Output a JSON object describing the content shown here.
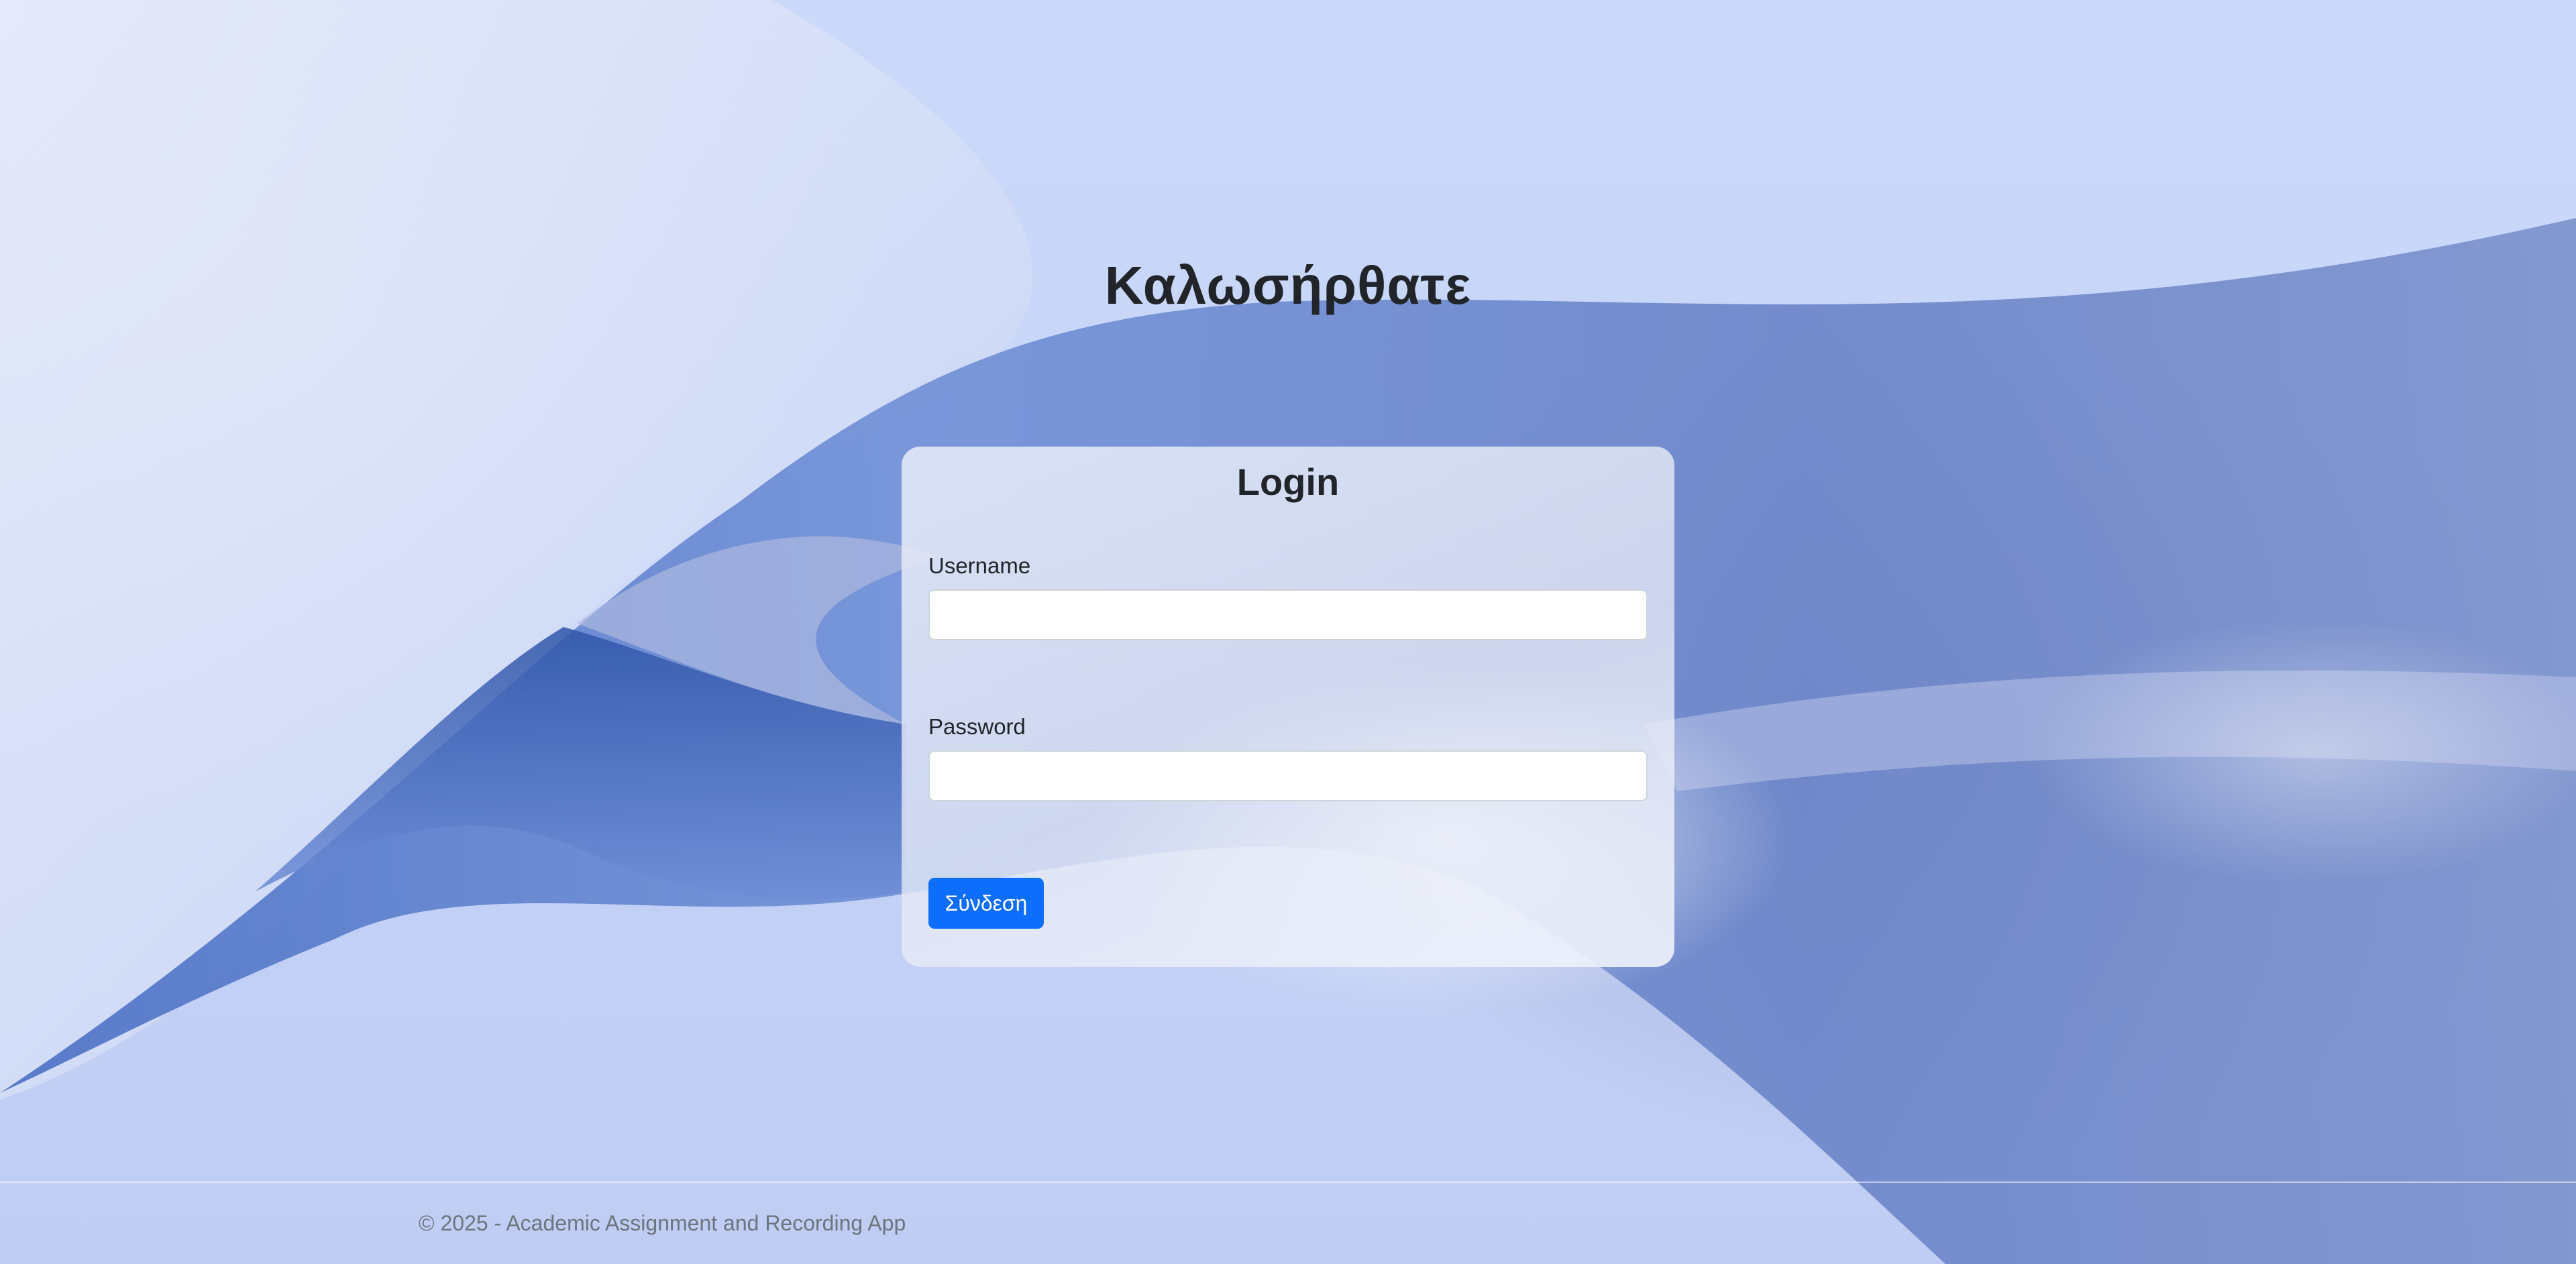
{
  "page": {
    "heading": "Καλωσήρθατε"
  },
  "login_card": {
    "title": "Login",
    "username_label": "Username",
    "username_value": "",
    "password_label": "Password",
    "password_value": "",
    "submit_label": "Σύνδεση"
  },
  "footer": {
    "text": "© 2025 - Academic Assignment and Recording App"
  },
  "colors": {
    "primary_button": "#0d6efd",
    "background": "#c9d6f7",
    "footer_text": "#6c757d",
    "heading_text": "#212529"
  }
}
